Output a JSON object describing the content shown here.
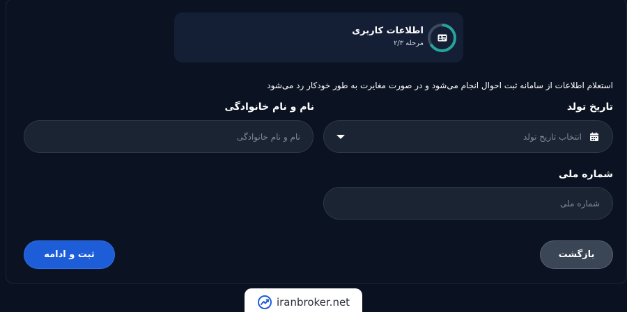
{
  "step": {
    "title": "اطلاعات کاربری",
    "subtitle": "مرحله ۲/۳",
    "progress": 0.67,
    "icon": "id-card-icon"
  },
  "notice": "استعلام اطلاعات از سامانه ثبت احوال انجام می‌شود و در صورت مغایرت به طور خودکار رد می‌شود",
  "form": {
    "birth_date": {
      "label": "تاریخ تولد",
      "placeholder": "انتخاب تاریخ تولد",
      "icon": "calendar-icon"
    },
    "full_name": {
      "label": "نام و نام خانوادگی",
      "placeholder": "نام و نام خانوادگی"
    },
    "national_id": {
      "label": "شماره ملی",
      "placeholder": "شماره ملی"
    }
  },
  "buttons": {
    "back": "بازگشت",
    "submit": "ثبت و ادامه"
  },
  "brand": {
    "name": "iranbroker.net"
  },
  "colors": {
    "accent": "#1d5ed8",
    "progress": "#28a39a",
    "background": "#0a1120",
    "card": "#141f36",
    "field": "#1a2433"
  }
}
